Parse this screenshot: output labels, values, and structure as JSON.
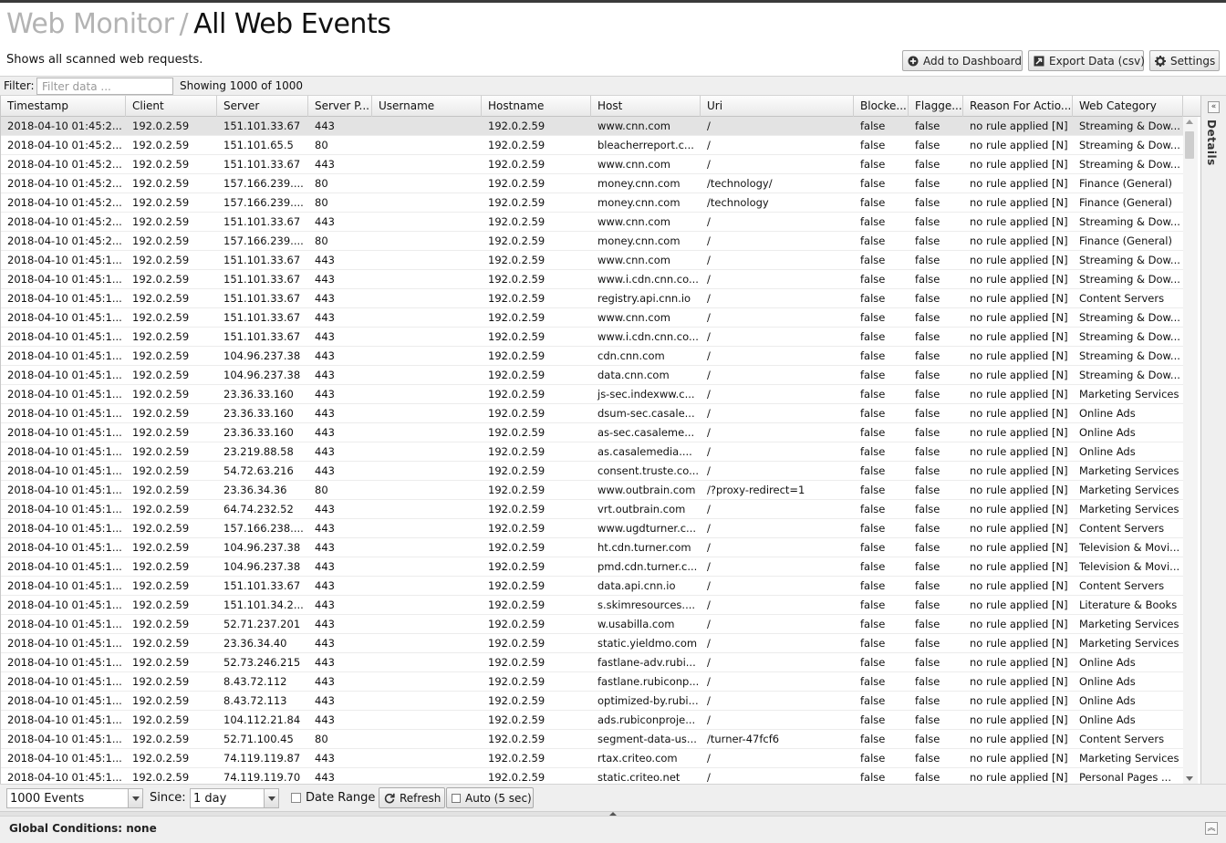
{
  "header": {
    "breadcrumb_parent": "Web Monitor",
    "separator": "/",
    "title": "All Web Events",
    "subtitle": "Shows all scanned web requests."
  },
  "actions": {
    "add_dashboard": "Add to Dashboard",
    "export": "Export Data (csv)",
    "settings": "Settings"
  },
  "filter": {
    "label": "Filter:",
    "placeholder": "Filter data ...",
    "count": "Showing 1000 of 1000"
  },
  "columns": [
    "Timestamp",
    "Client",
    "Server",
    "Server P...",
    "Username",
    "Hostname",
    "Host",
    "Uri",
    "Blocke...",
    "Flagge...",
    "Reason For Actio...",
    "Web Category"
  ],
  "rows": [
    [
      "2018-04-10 01:45:2...",
      "192.0.2.59",
      "151.101.33.67",
      "443",
      "",
      "192.0.2.59",
      "www.cnn.com",
      "/",
      "false",
      "false",
      "no rule applied [N]",
      "Streaming & Dow..."
    ],
    [
      "2018-04-10 01:45:2...",
      "192.0.2.59",
      "151.101.65.5",
      "80",
      "",
      "192.0.2.59",
      "bleacherreport.c...",
      "/",
      "false",
      "false",
      "no rule applied [N]",
      "Streaming & Dow..."
    ],
    [
      "2018-04-10 01:45:2...",
      "192.0.2.59",
      "151.101.33.67",
      "443",
      "",
      "192.0.2.59",
      "www.cnn.com",
      "/",
      "false",
      "false",
      "no rule applied [N]",
      "Streaming & Dow..."
    ],
    [
      "2018-04-10 01:45:2...",
      "192.0.2.59",
      "157.166.239....",
      "80",
      "",
      "192.0.2.59",
      "money.cnn.com",
      "/technology/",
      "false",
      "false",
      "no rule applied [N]",
      "Finance (General)"
    ],
    [
      "2018-04-10 01:45:2...",
      "192.0.2.59",
      "157.166.239....",
      "80",
      "",
      "192.0.2.59",
      "money.cnn.com",
      "/technology",
      "false",
      "false",
      "no rule applied [N]",
      "Finance (General)"
    ],
    [
      "2018-04-10 01:45:2...",
      "192.0.2.59",
      "151.101.33.67",
      "443",
      "",
      "192.0.2.59",
      "www.cnn.com",
      "/",
      "false",
      "false",
      "no rule applied [N]",
      "Streaming & Dow..."
    ],
    [
      "2018-04-10 01:45:2...",
      "192.0.2.59",
      "157.166.239....",
      "80",
      "",
      "192.0.2.59",
      "money.cnn.com",
      "/",
      "false",
      "false",
      "no rule applied [N]",
      "Finance (General)"
    ],
    [
      "2018-04-10 01:45:1...",
      "192.0.2.59",
      "151.101.33.67",
      "443",
      "",
      "192.0.2.59",
      "www.cnn.com",
      "/",
      "false",
      "false",
      "no rule applied [N]",
      "Streaming & Dow..."
    ],
    [
      "2018-04-10 01:45:1...",
      "192.0.2.59",
      "151.101.33.67",
      "443",
      "",
      "192.0.2.59",
      "www.i.cdn.cnn.co...",
      "/",
      "false",
      "false",
      "no rule applied [N]",
      "Streaming & Dow..."
    ],
    [
      "2018-04-10 01:45:1...",
      "192.0.2.59",
      "151.101.33.67",
      "443",
      "",
      "192.0.2.59",
      "registry.api.cnn.io",
      "/",
      "false",
      "false",
      "no rule applied [N]",
      "Content Servers"
    ],
    [
      "2018-04-10 01:45:1...",
      "192.0.2.59",
      "151.101.33.67",
      "443",
      "",
      "192.0.2.59",
      "www.cnn.com",
      "/",
      "false",
      "false",
      "no rule applied [N]",
      "Streaming & Dow..."
    ],
    [
      "2018-04-10 01:45:1...",
      "192.0.2.59",
      "151.101.33.67",
      "443",
      "",
      "192.0.2.59",
      "www.i.cdn.cnn.co...",
      "/",
      "false",
      "false",
      "no rule applied [N]",
      "Streaming & Dow..."
    ],
    [
      "2018-04-10 01:45:1...",
      "192.0.2.59",
      "104.96.237.38",
      "443",
      "",
      "192.0.2.59",
      "cdn.cnn.com",
      "/",
      "false",
      "false",
      "no rule applied [N]",
      "Streaming & Dow..."
    ],
    [
      "2018-04-10 01:45:1...",
      "192.0.2.59",
      "104.96.237.38",
      "443",
      "",
      "192.0.2.59",
      "data.cnn.com",
      "/",
      "false",
      "false",
      "no rule applied [N]",
      "Streaming & Dow..."
    ],
    [
      "2018-04-10 01:45:1...",
      "192.0.2.59",
      "23.36.33.160",
      "443",
      "",
      "192.0.2.59",
      "js-sec.indexww.c...",
      "/",
      "false",
      "false",
      "no rule applied [N]",
      "Marketing Services"
    ],
    [
      "2018-04-10 01:45:1...",
      "192.0.2.59",
      "23.36.33.160",
      "443",
      "",
      "192.0.2.59",
      "dsum-sec.casale...",
      "/",
      "false",
      "false",
      "no rule applied [N]",
      "Online Ads"
    ],
    [
      "2018-04-10 01:45:1...",
      "192.0.2.59",
      "23.36.33.160",
      "443",
      "",
      "192.0.2.59",
      "as-sec.casaleme...",
      "/",
      "false",
      "false",
      "no rule applied [N]",
      "Online Ads"
    ],
    [
      "2018-04-10 01:45:1...",
      "192.0.2.59",
      "23.219.88.58",
      "443",
      "",
      "192.0.2.59",
      "as.casalemedia....",
      "/",
      "false",
      "false",
      "no rule applied [N]",
      "Online Ads"
    ],
    [
      "2018-04-10 01:45:1...",
      "192.0.2.59",
      "54.72.63.216",
      "443",
      "",
      "192.0.2.59",
      "consent.truste.co...",
      "/",
      "false",
      "false",
      "no rule applied [N]",
      "Marketing Services"
    ],
    [
      "2018-04-10 01:45:1...",
      "192.0.2.59",
      "23.36.34.36",
      "80",
      "",
      "192.0.2.59",
      "www.outbrain.com",
      "/?proxy-redirect=1",
      "false",
      "false",
      "no rule applied [N]",
      "Marketing Services"
    ],
    [
      "2018-04-10 01:45:1...",
      "192.0.2.59",
      "64.74.232.52",
      "443",
      "",
      "192.0.2.59",
      "vrt.outbrain.com",
      "/",
      "false",
      "false",
      "no rule applied [N]",
      "Marketing Services"
    ],
    [
      "2018-04-10 01:45:1...",
      "192.0.2.59",
      "157.166.238....",
      "443",
      "",
      "192.0.2.59",
      "www.ugdturner.c...",
      "/",
      "false",
      "false",
      "no rule applied [N]",
      "Content Servers"
    ],
    [
      "2018-04-10 01:45:1...",
      "192.0.2.59",
      "104.96.237.38",
      "443",
      "",
      "192.0.2.59",
      "ht.cdn.turner.com",
      "/",
      "false",
      "false",
      "no rule applied [N]",
      "Television & Movi..."
    ],
    [
      "2018-04-10 01:45:1...",
      "192.0.2.59",
      "104.96.237.38",
      "443",
      "",
      "192.0.2.59",
      "pmd.cdn.turner.c...",
      "/",
      "false",
      "false",
      "no rule applied [N]",
      "Television & Movi..."
    ],
    [
      "2018-04-10 01:45:1...",
      "192.0.2.59",
      "151.101.33.67",
      "443",
      "",
      "192.0.2.59",
      "data.api.cnn.io",
      "/",
      "false",
      "false",
      "no rule applied [N]",
      "Content Servers"
    ],
    [
      "2018-04-10 01:45:1...",
      "192.0.2.59",
      "151.101.34.2...",
      "443",
      "",
      "192.0.2.59",
      "s.skimresources....",
      "/",
      "false",
      "false",
      "no rule applied [N]",
      "Literature & Books"
    ],
    [
      "2018-04-10 01:45:1...",
      "192.0.2.59",
      "52.71.237.201",
      "443",
      "",
      "192.0.2.59",
      "w.usabilla.com",
      "/",
      "false",
      "false",
      "no rule applied [N]",
      "Marketing Services"
    ],
    [
      "2018-04-10 01:45:1...",
      "192.0.2.59",
      "23.36.34.40",
      "443",
      "",
      "192.0.2.59",
      "static.yieldmo.com",
      "/",
      "false",
      "false",
      "no rule applied [N]",
      "Marketing Services"
    ],
    [
      "2018-04-10 01:45:1...",
      "192.0.2.59",
      "52.73.246.215",
      "443",
      "",
      "192.0.2.59",
      "fastlane-adv.rubi...",
      "/",
      "false",
      "false",
      "no rule applied [N]",
      "Online Ads"
    ],
    [
      "2018-04-10 01:45:1...",
      "192.0.2.59",
      "8.43.72.112",
      "443",
      "",
      "192.0.2.59",
      "fastlane.rubiconp...",
      "/",
      "false",
      "false",
      "no rule applied [N]",
      "Online Ads"
    ],
    [
      "2018-04-10 01:45:1...",
      "192.0.2.59",
      "8.43.72.113",
      "443",
      "",
      "192.0.2.59",
      "optimized-by.rubi...",
      "/",
      "false",
      "false",
      "no rule applied [N]",
      "Online Ads"
    ],
    [
      "2018-04-10 01:45:1...",
      "192.0.2.59",
      "104.112.21.84",
      "443",
      "",
      "192.0.2.59",
      "ads.rubiconproje...",
      "/",
      "false",
      "false",
      "no rule applied [N]",
      "Online Ads"
    ],
    [
      "2018-04-10 01:45:1...",
      "192.0.2.59",
      "52.71.100.45",
      "80",
      "",
      "192.0.2.59",
      "segment-data-us...",
      "/turner-47fcf6",
      "false",
      "false",
      "no rule applied [N]",
      "Content Servers"
    ],
    [
      "2018-04-10 01:45:1...",
      "192.0.2.59",
      "74.119.119.87",
      "443",
      "",
      "192.0.2.59",
      "rtax.criteo.com",
      "/",
      "false",
      "false",
      "no rule applied [N]",
      "Marketing Services"
    ],
    [
      "2018-04-10 01:45:1...",
      "192.0.2.59",
      "74.119.119.70",
      "443",
      "",
      "192.0.2.59",
      "static.criteo.net",
      "/",
      "false",
      "false",
      "no rule applied [N]",
      "Personal Pages ..."
    ]
  ],
  "side_panel": {
    "label": "Details"
  },
  "bottom": {
    "limit_value": "1000 Events",
    "since_label": "Since:",
    "since_value": "1 day",
    "date_range_label": "Date Range",
    "refresh_label": "Refresh",
    "auto_label": "Auto (5 sec)"
  },
  "global": {
    "conditions": "Global Conditions: none"
  },
  "icons": {
    "add": "plus-circle-icon",
    "export": "export-icon",
    "settings": "gear-icon",
    "refresh": "refresh-icon",
    "collapse": "double-chevron-left-icon",
    "expand": "double-chevron-up-icon"
  }
}
